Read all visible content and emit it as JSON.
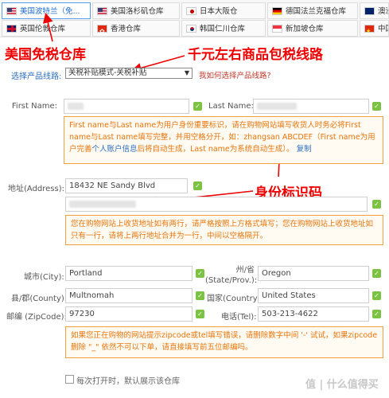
{
  "tabs": [
    {
      "label": "美国波特兰（免...",
      "flag": "us",
      "active": true
    },
    {
      "label": "美国洛杉矶仓库",
      "flag": "us"
    },
    {
      "label": "日本大阪仓",
      "flag": "jp"
    },
    {
      "label": "德国法兰克福仓库",
      "flag": "de"
    },
    {
      "label": "澳洲",
      "flag": "au"
    },
    {
      "label": "英国伦敦仓库",
      "flag": "uk"
    },
    {
      "label": "香港仓库",
      "flag": "hk"
    },
    {
      "label": "韩国仁川仓库",
      "flag": "kr"
    },
    {
      "label": "新加坡仓库",
      "flag": "sg"
    },
    {
      "label": "中国",
      "flag": "cn"
    }
  ],
  "annotations": {
    "tax_free": "美国免税仓库",
    "tax_line": "千元左右商品包税线路",
    "id_code": "身份标识码"
  },
  "route": {
    "label": "选择产品线路:",
    "selected": "关税补贴模式-关税补贴",
    "help": "我如何选择产品线路?"
  },
  "first_name": {
    "label": "First Name:"
  },
  "last_name": {
    "label": "Last Name:"
  },
  "name_note": {
    "text1": "First name与Last name为用户身份重要标识，请在购物网站填写收货人时务必将First name与Last name填写完整，并用空格分开，如：zhangsan ABCDEF（First name为用户完善",
    "link": "个人账户信息",
    "text2": "后将自动生成，Last name为系统自动生成）。",
    "copy": "复制"
  },
  "address": {
    "label": "地址(Address):",
    "line1": "18432 NE Sandy Blvd"
  },
  "address_note": "您在购物网站上收货地址如有两行，请严格按照上方格式填写；您在购物网站上收货地址如只有一行，请将上两行地址合并为一行，中间以空格隔开。",
  "city": {
    "label": "城市(City):",
    "value": "Portland"
  },
  "state": {
    "label_top": "州/省",
    "label_bottom": "(State/Prov.):",
    "value": "Oregon"
  },
  "county": {
    "label": "县/郡(County):",
    "value": "Multnomah"
  },
  "country": {
    "label": "国家(Country):",
    "value": "United States"
  },
  "zip": {
    "label": "邮编 (ZipCode):",
    "value": "97230"
  },
  "tel": {
    "label": "电话(Tel):",
    "value": "503-213-4622"
  },
  "zip_note": "如果您正在购物的网站提示zipcode或tel填写错误，请删除数字中间 '-' 试试，如果zipcode删除 \"_\" 依然不可以下单，请直接填写前五位邮编吗。",
  "remember": {
    "label": "每次打开时，默认展示该仓库"
  },
  "watermark": "值 | 什么值得买",
  "colors": {
    "accent": "#1d6fd1",
    "annotation": "#e00000",
    "note_text": "#e8760c",
    "note_border": "#f0a040"
  }
}
